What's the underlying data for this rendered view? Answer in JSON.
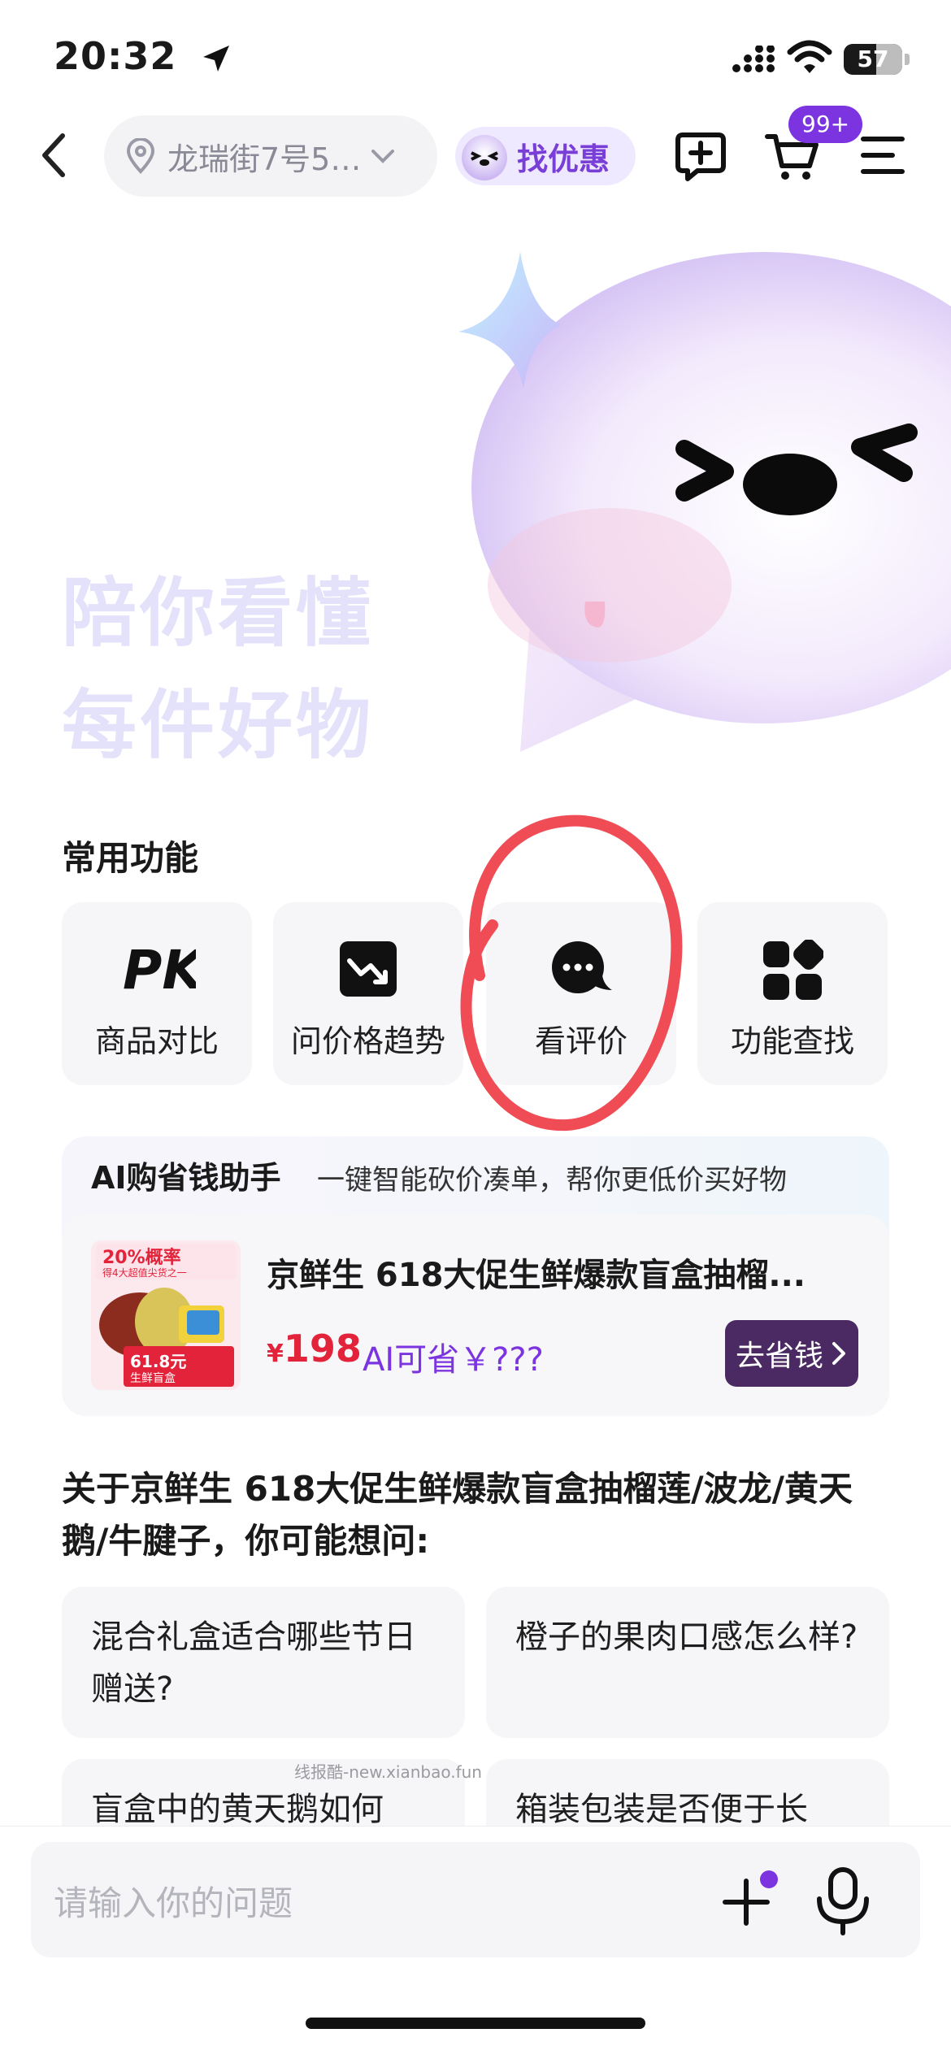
{
  "status_bar": {
    "time": "20:32",
    "battery": "57"
  },
  "nav": {
    "address": "龙瑞街7号5…",
    "deal_label": "找优惠",
    "cart_badge": "99+"
  },
  "hero": {
    "line1": "陪你看懂",
    "line2": "每件好物"
  },
  "common_functions": {
    "title": "常用功能",
    "items": [
      {
        "label": "商品对比",
        "icon": "pk-icon"
      },
      {
        "label": "问价格趋势",
        "icon": "price-trend-icon"
      },
      {
        "label": "看评价",
        "icon": "review-chat-icon"
      },
      {
        "label": "功能查找",
        "icon": "grid-icon"
      }
    ]
  },
  "ai_assistant": {
    "title": "AI购省钱助手",
    "subtitle": "一键智能砍价凑单，帮你更低价买好物",
    "product": {
      "title": "京鲜生 618大促生鲜爆款盲盒抽榴...",
      "price_symbol": "¥",
      "price": "198",
      "ai_save": "AI可省￥???",
      "button": "去省钱",
      "image_text": {
        "tag": "20%概率",
        "tag_sub": "得4大超值尖货之一",
        "box_text": "61.8元",
        "box_sub": "生鲜盲盒"
      }
    }
  },
  "questions": {
    "heading": "关于京鲜生 618大促生鲜爆款盲盒抽榴莲/波龙/黄天鹅/牛腱子，你可能想问:",
    "items": [
      "混合礼盒适合哪些节日赠送?",
      "橙子的果肉口感怎么样?",
      "盲盒中的黄天鹅如何",
      "箱装包装是否便于长"
    ]
  },
  "watermark": "线报酷-new.xianbao.fun",
  "input": {
    "placeholder": "请输入你的问题"
  },
  "colors": {
    "accent": "#7b34e0",
    "price_red": "#e2233a",
    "annotation_red": "#ef4c55",
    "save_button": "#4b2a63"
  }
}
